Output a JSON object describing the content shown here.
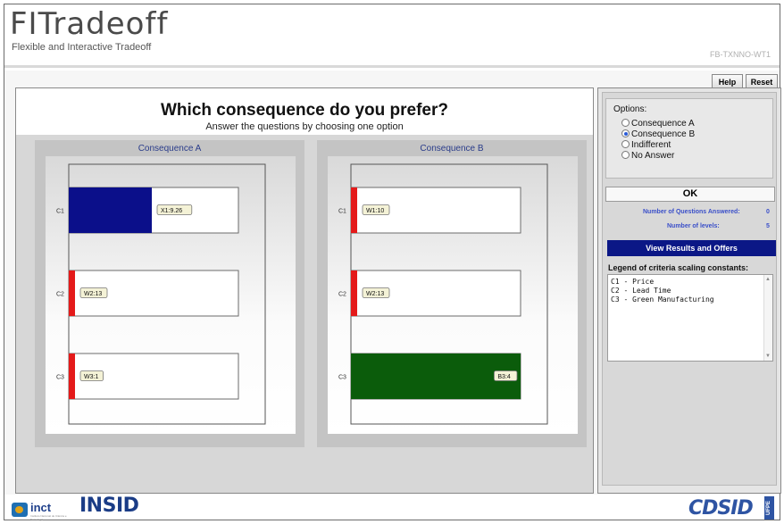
{
  "header": {
    "title": "FITradeoff",
    "subtitle": "Flexible and Interactive Tradeoff",
    "code": "FB-TXNNO-WT1",
    "help_label": "Help",
    "reset_label": "Reset"
  },
  "question": {
    "title": "Which consequence do you prefer?",
    "instruction": "Answer the questions by choosing one option"
  },
  "consequences": [
    {
      "name": "Consequence A",
      "bars": [
        {
          "criterion": "C1",
          "label": "X1:9.26",
          "fraction": 0.49,
          "color": "#0b0f8a"
        },
        {
          "criterion": "C2",
          "label": "W2:13",
          "fraction": 0.0,
          "color": "#e41a1a"
        },
        {
          "criterion": "C3",
          "label": "W3:1",
          "fraction": 0.0,
          "color": "#e41a1a"
        }
      ]
    },
    {
      "name": "Consequence B",
      "bars": [
        {
          "criterion": "C1",
          "label": "W1:10",
          "fraction": 0.0,
          "color": "#e41a1a"
        },
        {
          "criterion": "C2",
          "label": "W2:13",
          "fraction": 0.0,
          "color": "#e41a1a"
        },
        {
          "criterion": "C3",
          "label": "B3:4",
          "fraction": 1.0,
          "color": "#0b5c0b"
        }
      ]
    }
  ],
  "options": {
    "label": "Options:",
    "items": [
      "Consequence A",
      "Consequence B",
      "Indifferent",
      "No Answer"
    ],
    "selected": "Consequence B"
  },
  "ok_label": "OK",
  "stats": {
    "questions_label": "Number of Questions Answered:",
    "questions_value": "0",
    "levels_label": "Number of levels:",
    "levels_value": "5"
  },
  "view_results_label": "View Results and Offers",
  "legend": {
    "title": "Legend of criteria scaling constants:",
    "items": [
      "C1 - Price",
      "C2 - Lead Time",
      "C3 - Green Manufacturing"
    ]
  },
  "footer": {
    "inct": "inct",
    "inct_sub": "Instituto Nacional de Ciência e Tecnologia",
    "insid": "INSID",
    "cdsid": "CDSID",
    "ufpe": "UFPE"
  }
}
